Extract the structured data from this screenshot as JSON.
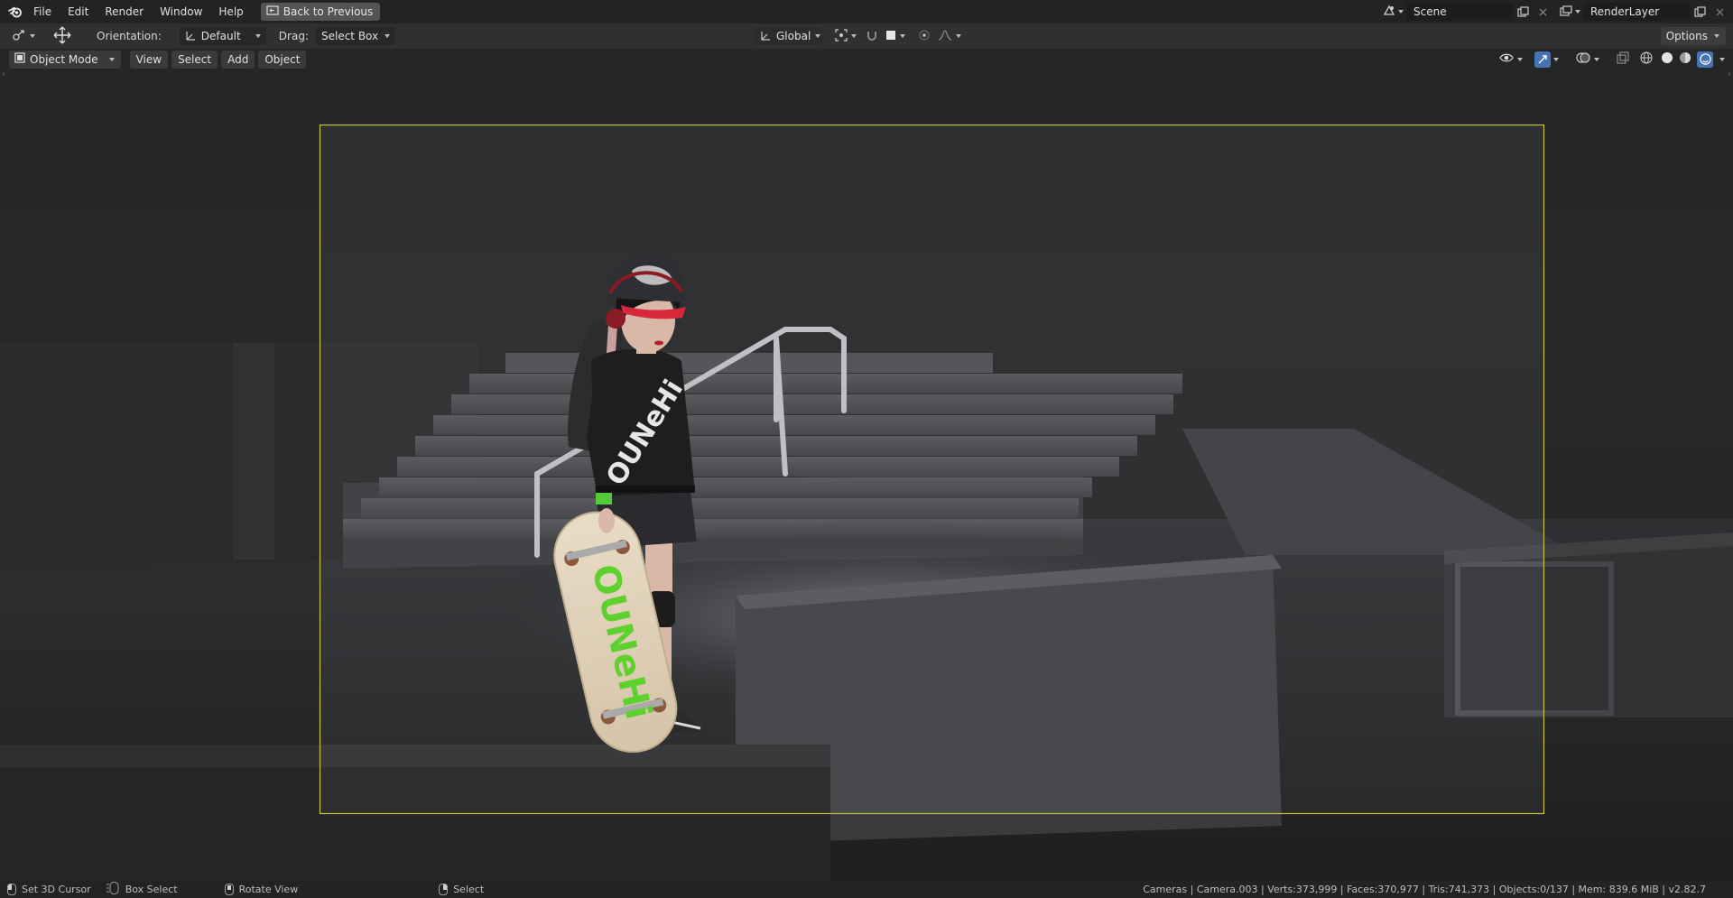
{
  "topbar": {
    "menus": [
      "File",
      "Edit",
      "Render",
      "Window",
      "Help"
    ],
    "back_button": "Back to Previous",
    "scene_name": "Scene",
    "render_layer": "RenderLayer"
  },
  "toolbar": {
    "orientation_label": "Orientation:",
    "orientation_value": "Default",
    "drag_label": "Drag:",
    "drag_value": "Select Box",
    "transform_orientation": "Global",
    "options_label": "Options"
  },
  "viewport_header": {
    "mode": "Object Mode",
    "menus": [
      "View",
      "Select",
      "Add",
      "Object"
    ]
  },
  "shirt_text": "OUNeHi",
  "board_text": "OUNeHi",
  "statusbar": {
    "hint_left_click": "Set 3D Cursor",
    "hint_drag": "Box Select",
    "hint_middle": "Rotate View",
    "hint_right": "Select",
    "stats": "Cameras | Camera.003 | Verts:373,999 | Faces:370,977 | Tris:741,373 | Objects:0/137 | Mem: 839.6 MiB | v2.82.7"
  },
  "colors": {
    "camera_frame": "#c9c542",
    "accent_blue": "#4772b3",
    "board_green": "#5ed12e"
  }
}
